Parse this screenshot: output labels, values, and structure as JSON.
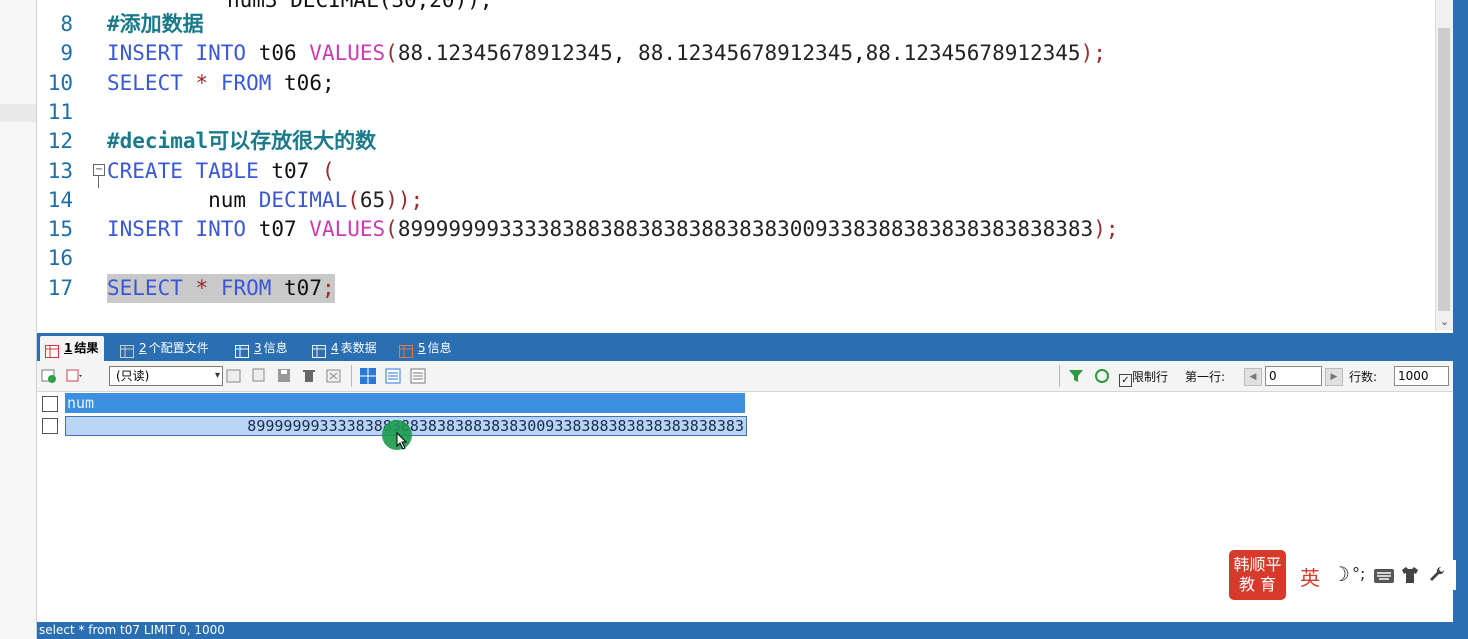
{
  "editor": {
    "lines": [
      {
        "no": "8",
        "parts": [
          {
            "t": "#添加数据",
            "c": "cmt"
          }
        ]
      },
      {
        "no": "9",
        "parts": [
          {
            "t": "INSERT INTO ",
            "c": "kw"
          },
          {
            "t": "t06 ",
            "c": "plain"
          },
          {
            "t": "VALUES",
            "c": "fn"
          },
          {
            "t": "(",
            "c": "op"
          },
          {
            "t": "88.12345678912345",
            "c": "num"
          },
          {
            "t": ", ",
            "c": "plain"
          },
          {
            "t": "88.12345678912345",
            "c": "num"
          },
          {
            "t": ",",
            "c": "plain"
          },
          {
            "t": "88.12345678912345",
            "c": "num"
          },
          {
            "t": ");",
            "c": "op"
          }
        ]
      },
      {
        "no": "10",
        "parts": [
          {
            "t": "SELECT ",
            "c": "kw"
          },
          {
            "t": "* ",
            "c": "op"
          },
          {
            "t": "FROM ",
            "c": "kw"
          },
          {
            "t": "t06",
            "c": "plain"
          },
          {
            "t": ";",
            "c": "plain"
          }
        ]
      },
      {
        "no": "11",
        "parts": []
      },
      {
        "no": "12",
        "parts": [
          {
            "t": "#decimal可以存放很大的数",
            "c": "cmt"
          }
        ]
      },
      {
        "no": "13",
        "parts": [
          {
            "t": "CREATE TABLE ",
            "c": "kw"
          },
          {
            "t": "t07 ",
            "c": "plain"
          },
          {
            "t": "(",
            "c": "op"
          }
        ]
      },
      {
        "no": "14",
        "parts": [
          {
            "t": "        num ",
            "c": "plain"
          },
          {
            "t": "DECIMAL",
            "c": "kw"
          },
          {
            "t": "(",
            "c": "op"
          },
          {
            "t": "65",
            "c": "num"
          },
          {
            "t": "));",
            "c": "op"
          }
        ]
      },
      {
        "no": "15",
        "parts": [
          {
            "t": "INSERT INTO ",
            "c": "kw"
          },
          {
            "t": "t07 ",
            "c": "plain"
          },
          {
            "t": "VALUES",
            "c": "fn"
          },
          {
            "t": "(",
            "c": "op"
          },
          {
            "t": "8999999933338388388383838838383009338388383838383838383",
            "c": "num"
          },
          {
            "t": ");",
            "c": "op"
          }
        ]
      },
      {
        "no": "16",
        "parts": []
      },
      {
        "no": "17",
        "parts": [
          {
            "t": "SELECT ",
            "c": "kw"
          },
          {
            "t": "* ",
            "c": "op"
          },
          {
            "t": "FROM ",
            "c": "kw"
          },
          {
            "t": "t07",
            "c": "plain"
          },
          {
            "t": ";",
            "c": "op"
          }
        ]
      }
    ],
    "partial_top_line": "num3 DECIMAL(30,20));"
  },
  "tabs": [
    {
      "num": "1",
      "label": "结果"
    },
    {
      "num": "2",
      "label": "个配置文件"
    },
    {
      "num": "3",
      "label": "信息"
    },
    {
      "num": "4",
      "label": "表数据"
    },
    {
      "num": "5",
      "label": "信息"
    }
  ],
  "toolbar": {
    "mode_select": "(只读)",
    "limit_rows_label": "限制行",
    "first_row_label": "第一行:",
    "first_row_value": "0",
    "rows_label": "行数:",
    "rows_value": "1000"
  },
  "grid": {
    "column": "num",
    "value": "8999999933338388388383838838383009338388383838383838383"
  },
  "ime": {
    "logo": "韩顺平\n教 育",
    "lang": "英",
    "moon": "☽",
    "punct": "°;"
  },
  "status": {
    "text": "select * from t07 LIMIT 0, 1000"
  }
}
